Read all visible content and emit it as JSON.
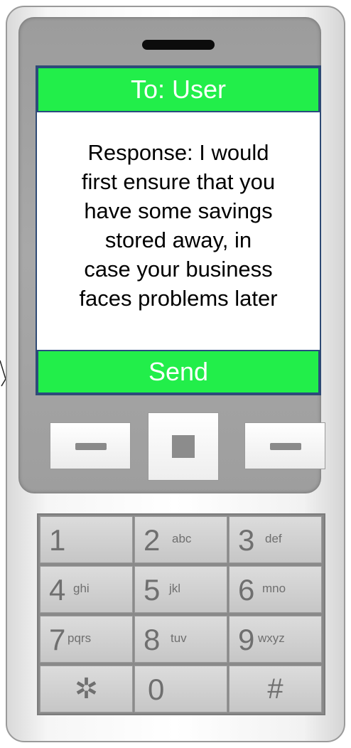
{
  "screen": {
    "to_label": "To: User",
    "message_lines": [
      "Response: I would",
      "first ensure that you",
      "have some savings",
      "stored away, in",
      "case your business",
      "faces problems later"
    ],
    "send_label": "Send"
  },
  "keypad": {
    "keys": [
      {
        "num": "1",
        "letters": ""
      },
      {
        "num": "2",
        "letters": "abc"
      },
      {
        "num": "3",
        "letters": "def"
      },
      {
        "num": "4",
        "letters": "ghi"
      },
      {
        "num": "5",
        "letters": "jkl"
      },
      {
        "num": "6",
        "letters": "mno"
      },
      {
        "num": "7",
        "letters": "pqrs"
      },
      {
        "num": "8",
        "letters": "tuv"
      },
      {
        "num": "9",
        "letters": "wxyz"
      },
      {
        "num": "✲",
        "letters": ""
      },
      {
        "num": "0",
        "letters": ""
      },
      {
        "num": "#",
        "letters": ""
      }
    ]
  },
  "icons": {
    "left_softkey": "dash-icon",
    "center_key": "square-icon",
    "right_softkey": "dash-icon"
  },
  "colors": {
    "bar_green": "#22ee4a",
    "bar_border": "#2a4a80",
    "bar_text": "#ffffff"
  }
}
